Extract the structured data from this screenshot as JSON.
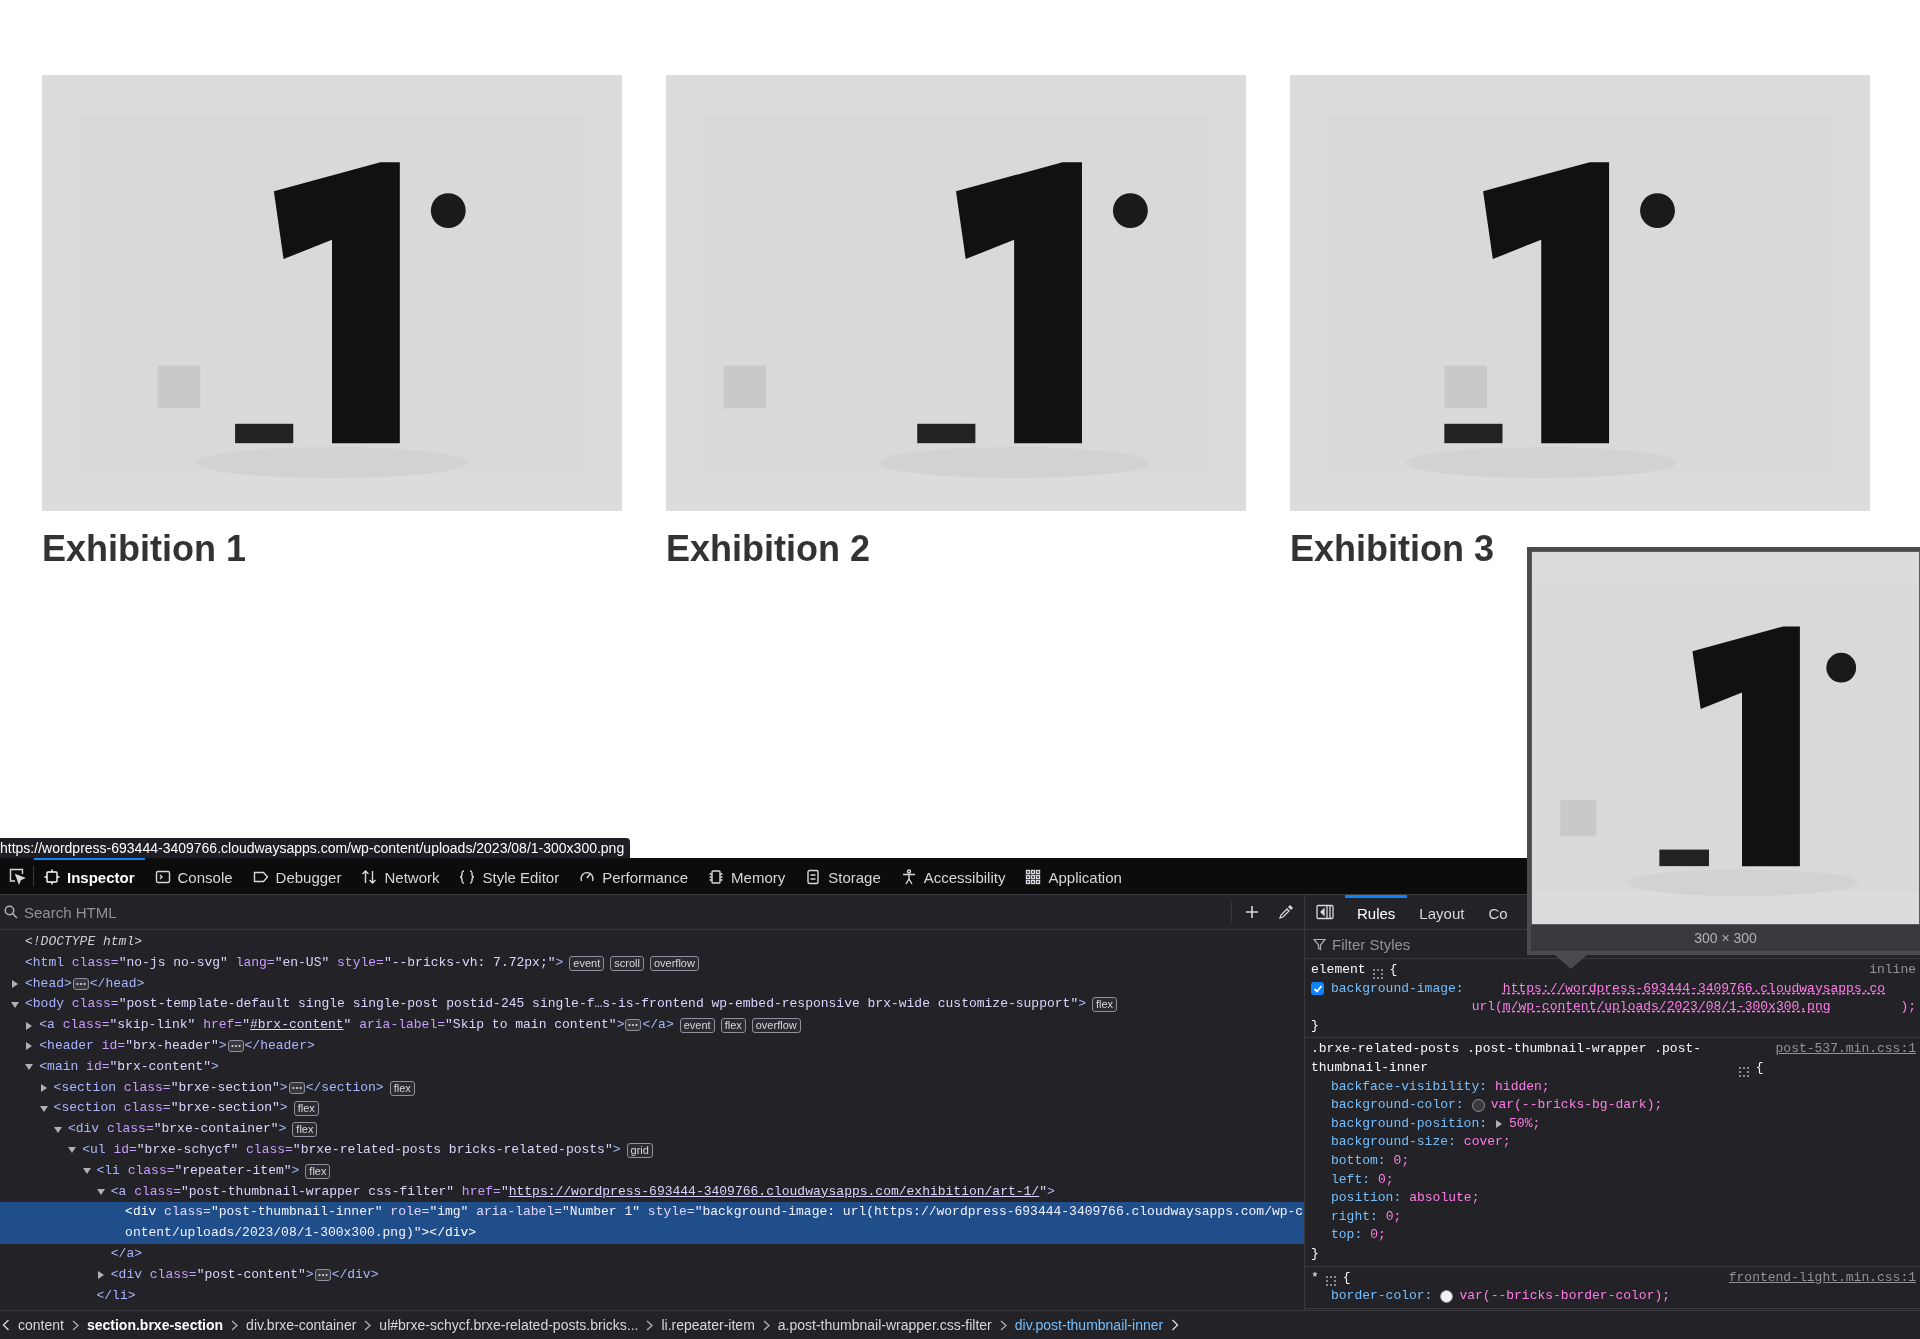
{
  "page": {
    "cards": [
      {
        "title": "Exhibition 1"
      },
      {
        "title": "Exhibition 2"
      },
      {
        "title": "Exhibition 3"
      }
    ]
  },
  "status_link": "https://wordpress-693444-3409766.cloudwaysapps.com/wp-content/uploads/2023/08/1-300x300.png",
  "devtools": {
    "tabs": [
      {
        "label": "Inspector",
        "selected": true
      },
      {
        "label": "Console",
        "selected": false
      },
      {
        "label": "Debugger",
        "selected": false
      },
      {
        "label": "Network",
        "selected": false
      },
      {
        "label": "Style Editor",
        "selected": false
      },
      {
        "label": "Performance",
        "selected": false
      },
      {
        "label": "Memory",
        "selected": false
      },
      {
        "label": "Storage",
        "selected": false
      },
      {
        "label": "Accessibility",
        "selected": false
      },
      {
        "label": "Application",
        "selected": false
      }
    ],
    "search": {
      "placeholder": "Search HTML"
    },
    "tree": [
      {
        "selected": false,
        "parts": [
          {
            "kind": "doctype",
            "text": "<!DOCTYPE html>"
          }
        ]
      },
      {
        "selected": false,
        "parts": [
          {
            "kind": "tag",
            "text": "<html"
          },
          {
            "kind": "attr",
            "text": " class="
          },
          {
            "kind": "value",
            "text": "\"no-js no-svg\""
          },
          {
            "kind": "attr",
            "text": " lang="
          },
          {
            "kind": "value",
            "text": "\"en-US\""
          },
          {
            "kind": "attr",
            "text": " style="
          },
          {
            "kind": "value",
            "text": "\"--bricks-vh: 7.72px;\""
          },
          {
            "kind": "tag",
            "text": ">"
          }
        ],
        "badges": [
          "event",
          "scroll",
          "overflow"
        ]
      },
      {
        "selected": false,
        "expanded": false,
        "parts": [
          {
            "kind": "tag",
            "text": "<head>"
          },
          {
            "kind": "more"
          },
          {
            "kind": "tag",
            "text": "</head>"
          }
        ]
      },
      {
        "selected": false,
        "expanded": true,
        "parts": [
          {
            "kind": "tag",
            "text": "<body"
          },
          {
            "kind": "attr",
            "text": " class="
          },
          {
            "kind": "value",
            "text": "\"post-template-default single single-post postid-245 single-f…s-is-frontend wp-embed-responsive brx-wide customize-support\""
          },
          {
            "kind": "tag",
            "text": ">"
          }
        ],
        "badges": [
          "flex"
        ],
        "children": [
          {
            "selected": false,
            "expanded": false,
            "parts": [
              {
                "kind": "tag",
                "text": "<a"
              },
              {
                "kind": "attr",
                "text": " class="
              },
              {
                "kind": "value",
                "text": "\"skip-link\""
              },
              {
                "kind": "attr",
                "text": " href="
              },
              {
                "kind": "value",
                "text": "\""
              },
              {
                "kind": "link",
                "text": "#brx-content"
              },
              {
                "kind": "value",
                "text": "\""
              },
              {
                "kind": "attr",
                "text": " aria-label="
              },
              {
                "kind": "value",
                "text": "\"Skip to main content\""
              },
              {
                "kind": "tag",
                "text": ">"
              },
              {
                "kind": "more"
              },
              {
                "kind": "tag",
                "text": "</a>"
              }
            ],
            "badges": [
              "event",
              "flex",
              "overflow"
            ]
          },
          {
            "selected": false,
            "expanded": false,
            "parts": [
              {
                "kind": "tag",
                "text": "<header"
              },
              {
                "kind": "attr",
                "text": " id="
              },
              {
                "kind": "value",
                "text": "\"brx-header\""
              },
              {
                "kind": "tag",
                "text": ">"
              },
              {
                "kind": "more"
              },
              {
                "kind": "tag",
                "text": "</header>"
              }
            ]
          },
          {
            "selected": false,
            "expanded": true,
            "parts": [
              {
                "kind": "tag",
                "text": "<main"
              },
              {
                "kind": "attr",
                "text": " id="
              },
              {
                "kind": "value",
                "text": "\"brx-content\""
              },
              {
                "kind": "tag",
                "text": ">"
              }
            ],
            "children": [
              {
                "selected": false,
                "expanded": false,
                "parts": [
                  {
                    "kind": "tag",
                    "text": "<section"
                  },
                  {
                    "kind": "attr",
                    "text": " class="
                  },
                  {
                    "kind": "value",
                    "text": "\"brxe-section\""
                  },
                  {
                    "kind": "tag",
                    "text": ">"
                  },
                  {
                    "kind": "more"
                  },
                  {
                    "kind": "tag",
                    "text": "</section>"
                  }
                ],
                "badges": [
                  "flex"
                ]
              },
              {
                "selected": false,
                "expanded": true,
                "parts": [
                  {
                    "kind": "tag",
                    "text": "<section"
                  },
                  {
                    "kind": "attr",
                    "text": " class="
                  },
                  {
                    "kind": "value",
                    "text": "\"brxe-section\""
                  },
                  {
                    "kind": "tag",
                    "text": ">"
                  }
                ],
                "badges": [
                  "flex"
                ],
                "children": [
                  {
                    "selected": false,
                    "expanded": true,
                    "parts": [
                      {
                        "kind": "tag",
                        "text": "<div"
                      },
                      {
                        "kind": "attr",
                        "text": " class="
                      },
                      {
                        "kind": "value",
                        "text": "\"brxe-container\""
                      },
                      {
                        "kind": "tag",
                        "text": ">"
                      }
                    ],
                    "badges": [
                      "flex"
                    ],
                    "children": [
                      {
                        "selected": false,
                        "expanded": true,
                        "parts": [
                          {
                            "kind": "tag",
                            "text": "<ul"
                          },
                          {
                            "kind": "attr",
                            "text": " id="
                          },
                          {
                            "kind": "value",
                            "text": "\"brxe-schycf\""
                          },
                          {
                            "kind": "attr",
                            "text": " class="
                          },
                          {
                            "kind": "value",
                            "text": "\"brxe-related-posts bricks-related-posts\""
                          },
                          {
                            "kind": "tag",
                            "text": ">"
                          }
                        ],
                        "badges": [
                          "grid"
                        ],
                        "children": [
                          {
                            "selected": false,
                            "expanded": true,
                            "parts": [
                              {
                                "kind": "tag",
                                "text": "<li"
                              },
                              {
                                "kind": "attr",
                                "text": " class="
                              },
                              {
                                "kind": "value",
                                "text": "\"repeater-item\""
                              },
                              {
                                "kind": "tag",
                                "text": ">"
                              }
                            ],
                            "badges": [
                              "flex"
                            ],
                            "children": [
                              {
                                "selected": false,
                                "expanded": true,
                                "parts": [
                                  {
                                    "kind": "tag",
                                    "text": "<a"
                                  },
                                  {
                                    "kind": "attr",
                                    "text": " class="
                                  },
                                  {
                                    "kind": "value",
                                    "text": "\"post-thumbnail-wrapper css-filter\""
                                  },
                                  {
                                    "kind": "attr",
                                    "text": " href="
                                  },
                                  {
                                    "kind": "value",
                                    "text": "\""
                                  },
                                  {
                                    "kind": "link",
                                    "text": "https://wordpress-693444-3409766.cloudwaysapps.com/exhibition/art-1/"
                                  },
                                  {
                                    "kind": "value",
                                    "text": "\""
                                  },
                                  {
                                    "kind": "tag",
                                    "text": ">"
                                  }
                                ],
                                "children": [
                                  {
                                    "selected": true,
                                    "parts": [
                                      {
                                        "kind": "tag",
                                        "text": "<div"
                                      },
                                      {
                                        "kind": "attr",
                                        "text": " class="
                                      },
                                      {
                                        "kind": "value",
                                        "text": "\"post-thumbnail-inner\""
                                      },
                                      {
                                        "kind": "attr",
                                        "text": " role="
                                      },
                                      {
                                        "kind": "value",
                                        "text": "\"img\""
                                      },
                                      {
                                        "kind": "attr",
                                        "text": " aria-label="
                                      },
                                      {
                                        "kind": "value",
                                        "text": "\"Number 1\""
                                      },
                                      {
                                        "kind": "attr",
                                        "text": " style="
                                      },
                                      {
                                        "kind": "value",
                                        "text": "\"background-image: url(https://wordpress-693444-3409766.cloudwaysapps.com/wp-content/uploads/2023/08/1-300x300.png)\""
                                      },
                                      {
                                        "kind": "tag",
                                        "text": "></div>"
                                      }
                                    ]
                                  }
                                ],
                                "closing": [
                                  {
                                    "kind": "tag",
                                    "text": "</a>"
                                  }
                                ]
                              },
                              {
                                "selected": false,
                                "expanded": false,
                                "parts": [
                                  {
                                    "kind": "tag",
                                    "text": "<div"
                                  },
                                  {
                                    "kind": "attr",
                                    "text": " class="
                                  },
                                  {
                                    "kind": "value",
                                    "text": "\"post-content\""
                                  },
                                  {
                                    "kind": "tag",
                                    "text": ">"
                                  },
                                  {
                                    "kind": "more"
                                  },
                                  {
                                    "kind": "tag",
                                    "text": "</div>"
                                  }
                                ]
                              }
                            ],
                            "closing": [
                              {
                                "kind": "tag",
                                "text": "</li>"
                              }
                            ]
                          }
                        ]
                      }
                    ]
                  }
                ]
              }
            ]
          }
        ]
      }
    ],
    "breadcrumbs": [
      {
        "label": "content",
        "selected": false,
        "hovered": false
      },
      {
        "label": "section.brxe-section",
        "selected": false,
        "hovered": true
      },
      {
        "label": "div.brxe-container",
        "selected": false,
        "hovered": false
      },
      {
        "label": "ul#brxe-schycf.brxe-related-posts.bricks...",
        "selected": false,
        "hovered": false
      },
      {
        "label": "li.repeater-item",
        "selected": false,
        "hovered": false
      },
      {
        "label": "a.post-thumbnail-wrapper.css-filter",
        "selected": false,
        "hovered": false
      },
      {
        "label": "div.post-thumbnail-inner",
        "selected": true,
        "hovered": false
      }
    ],
    "sidebar": {
      "tabs": [
        {
          "label": "Rules",
          "selected": true
        },
        {
          "label": "Layout",
          "selected": false
        },
        {
          "label": "Co",
          "selected": false
        }
      ],
      "filter": {
        "placeholder": "Filter Styles"
      },
      "rules": [
        {
          "selector": "element",
          "brace_open": "{",
          "source": {
            "text": "inline",
            "kind": "label"
          },
          "brace_close": "}",
          "declarations": [
            {
              "property": "background-image:",
              "checked": true,
              "value": [
                {
                  "kind": "fn",
                  "text": "url("
                },
                {
                  "kind": "link",
                  "text": "https://wordpress-693444-3409766.cloudwaysapps.com/wp-content/uploads/2023/08/1-300x300.png"
                },
                {
                  "kind": "fn",
                  "text": ");"
                }
              ]
            }
          ]
        },
        {
          "selector": ".brxe-related-posts .post-thumbnail-wrapper .post-thumbnail-inner",
          "brace_open": "{",
          "source": {
            "text": "post-537.min.css:1",
            "kind": "link"
          },
          "brace_close": "}",
          "declarations": [
            {
              "property": "backface-visibility:",
              "value": [
                {
                  "kind": "fn",
                  "text": "hidden;"
                }
              ]
            },
            {
              "property": "background-color:",
              "color": "#3b3b3f",
              "value": [
                {
                  "kind": "fn",
                  "text": "var(--bricks-bg-dark);"
                }
              ]
            },
            {
              "property": "background-position:",
              "expanded": false,
              "value": [
                {
                  "kind": "fn",
                  "text": "50%;"
                }
              ]
            },
            {
              "property": "background-size:",
              "value": [
                {
                  "kind": "fn",
                  "text": "cover;"
                }
              ]
            },
            {
              "property": "bottom:",
              "value": [
                {
                  "kind": "fn",
                  "text": "0;"
                }
              ]
            },
            {
              "property": "left:",
              "value": [
                {
                  "kind": "fn",
                  "text": "0;"
                }
              ]
            },
            {
              "property": "position:",
              "value": [
                {
                  "kind": "fn",
                  "text": "absolute;"
                }
              ]
            },
            {
              "property": "right:",
              "value": [
                {
                  "kind": "fn",
                  "text": "0;"
                }
              ]
            },
            {
              "property": "top:",
              "value": [
                {
                  "kind": "fn",
                  "text": "0;"
                }
              ]
            }
          ]
        },
        {
          "selector": "*",
          "brace_open": "{",
          "source": {
            "text": "frontend-light.min.css:1",
            "kind": "link"
          },
          "declarations": [
            {
              "property": "border-color:",
              "color": "#f2f2f2",
              "value": [
                {
                  "kind": "fn",
                  "text": "var(--bricks-border-color);"
                }
              ]
            }
          ]
        }
      ]
    },
    "image_tooltip": {
      "size": "300 × 300"
    }
  }
}
